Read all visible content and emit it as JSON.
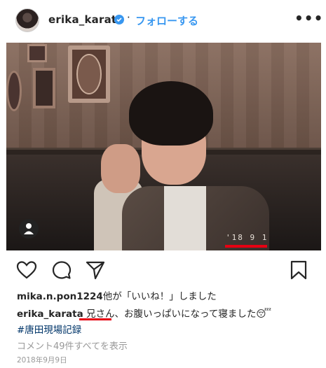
{
  "header": {
    "username": "erika_karata",
    "separator": "·",
    "follow_label": "フォローする",
    "more_label": "•••"
  },
  "photo": {
    "overlay_text": "'18  9  1"
  },
  "likes": {
    "user": "mika.n.pon1224",
    "text": "他が「いいね！」しました"
  },
  "caption": {
    "user": "erika_karata",
    "text": "兄さん、お腹いっぱいになって寝ました😴",
    "hashtag": "#唐田現場記録"
  },
  "comments_link": "コメント49件すべてを表示",
  "date": "2018年9月9日",
  "colors": {
    "accent": "#3897f0",
    "highlight": "#e60012",
    "hashtag": "#003569",
    "muted": "#999999"
  }
}
